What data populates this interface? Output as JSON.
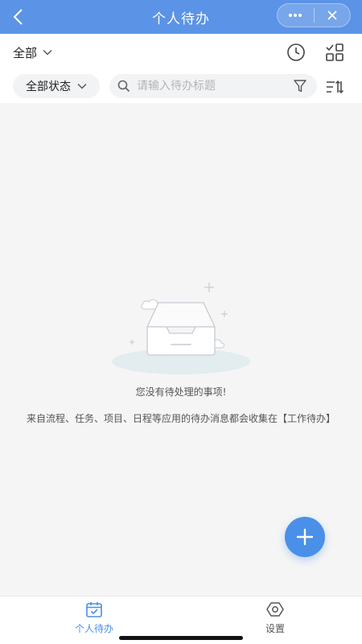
{
  "header": {
    "title": "个人待办",
    "back_icon": "chevron-left-icon",
    "more_icon": "more-dots-icon",
    "close_icon": "close-icon"
  },
  "filters": {
    "scope_label": "全部",
    "history_icon": "clock-icon",
    "grid_icon": "grid-check-icon",
    "status_label": "全部状态",
    "search_placeholder": "请输入待办标题",
    "search_value": "",
    "filter_icon": "funnel-icon",
    "sort_icon": "sort-icon"
  },
  "empty_state": {
    "title": "您没有待处理的事项!",
    "description": "来自流程、任务、项目、日程等应用的待办消息都会收集在【工作待办】"
  },
  "fab": {
    "icon": "plus-icon"
  },
  "tabbar": {
    "items": [
      {
        "label": "个人待办",
        "icon": "calendar-check-icon",
        "active": true
      },
      {
        "label": "设置",
        "icon": "settings-hexagon-icon",
        "active": false
      }
    ]
  },
  "colors": {
    "header": "#5b93e6",
    "accent": "#4a90e8",
    "background": "#f5f5f5"
  }
}
